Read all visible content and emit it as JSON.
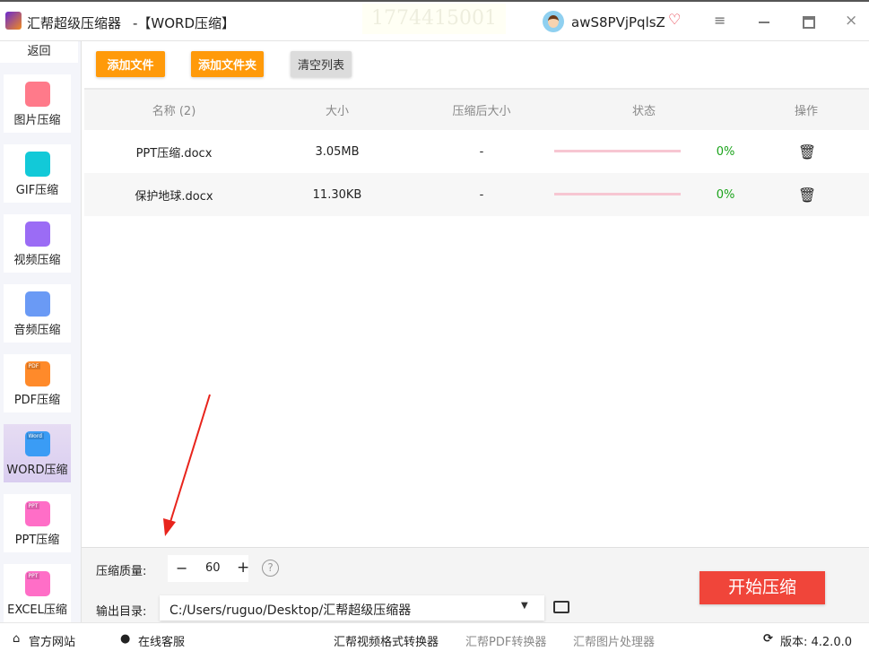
{
  "titlebar": {
    "app_name": "汇帮超级压缩器",
    "mode": "-【WORD压缩】",
    "watermark": "1774415001",
    "username": "awS8PVjPqlsZ"
  },
  "sidebar": {
    "back": "返回",
    "items": [
      {
        "label": "图片压缩",
        "color": "#ff7a8a"
      },
      {
        "label": "GIF压缩",
        "color": "#12c9d8"
      },
      {
        "label": "视频压缩",
        "color": "#9b6cf5"
      },
      {
        "label": "音频压缩",
        "color": "#6a9af5"
      },
      {
        "label": "PDF压缩",
        "color": "#ff8a2a",
        "tag": "PDF"
      },
      {
        "label": "WORD压缩",
        "color": "#3a9cf5",
        "tag": "Word",
        "active": true
      },
      {
        "label": "PPT压缩",
        "color": "#ff6ec7",
        "tag": "PPT"
      },
      {
        "label": "EXCEL压缩",
        "color": "#ff6ec7",
        "tag": "PPT"
      }
    ]
  },
  "toolbar": {
    "add_file": "添加文件",
    "add_folder": "添加文件夹",
    "clear_list": "清空列表"
  },
  "table": {
    "headers": [
      "名称 (2)",
      "大小",
      "压缩后大小",
      "状态",
      "操作"
    ],
    "rows": [
      {
        "name": "PPT压缩.docx",
        "size": "3.05MB",
        "compressed": "-",
        "progress": 0,
        "percent": "0%"
      },
      {
        "name": "保护地球.docx",
        "size": "11.30KB",
        "compressed": "-",
        "progress": 0,
        "percent": "0%"
      }
    ]
  },
  "settings": {
    "quality_label": "压缩质量:",
    "quality": "60",
    "minus": "−",
    "plus": "+",
    "help": "?",
    "output_label": "输出目录:",
    "output_path": "C:/Users/ruguo/Desktop/汇帮超级压缩器",
    "start": "开始压缩"
  },
  "footer": {
    "website": "官方网站",
    "support": "在线客服",
    "links": [
      "汇帮视频格式转换器",
      "汇帮PDF转换器",
      "汇帮图片处理器"
    ],
    "version": "版本: 4.2.0.0"
  },
  "colors": {
    "accent": "#ff9a0a",
    "start": "#f0453a",
    "progress": "#f7c6d2",
    "percent": "#1ba31b"
  }
}
